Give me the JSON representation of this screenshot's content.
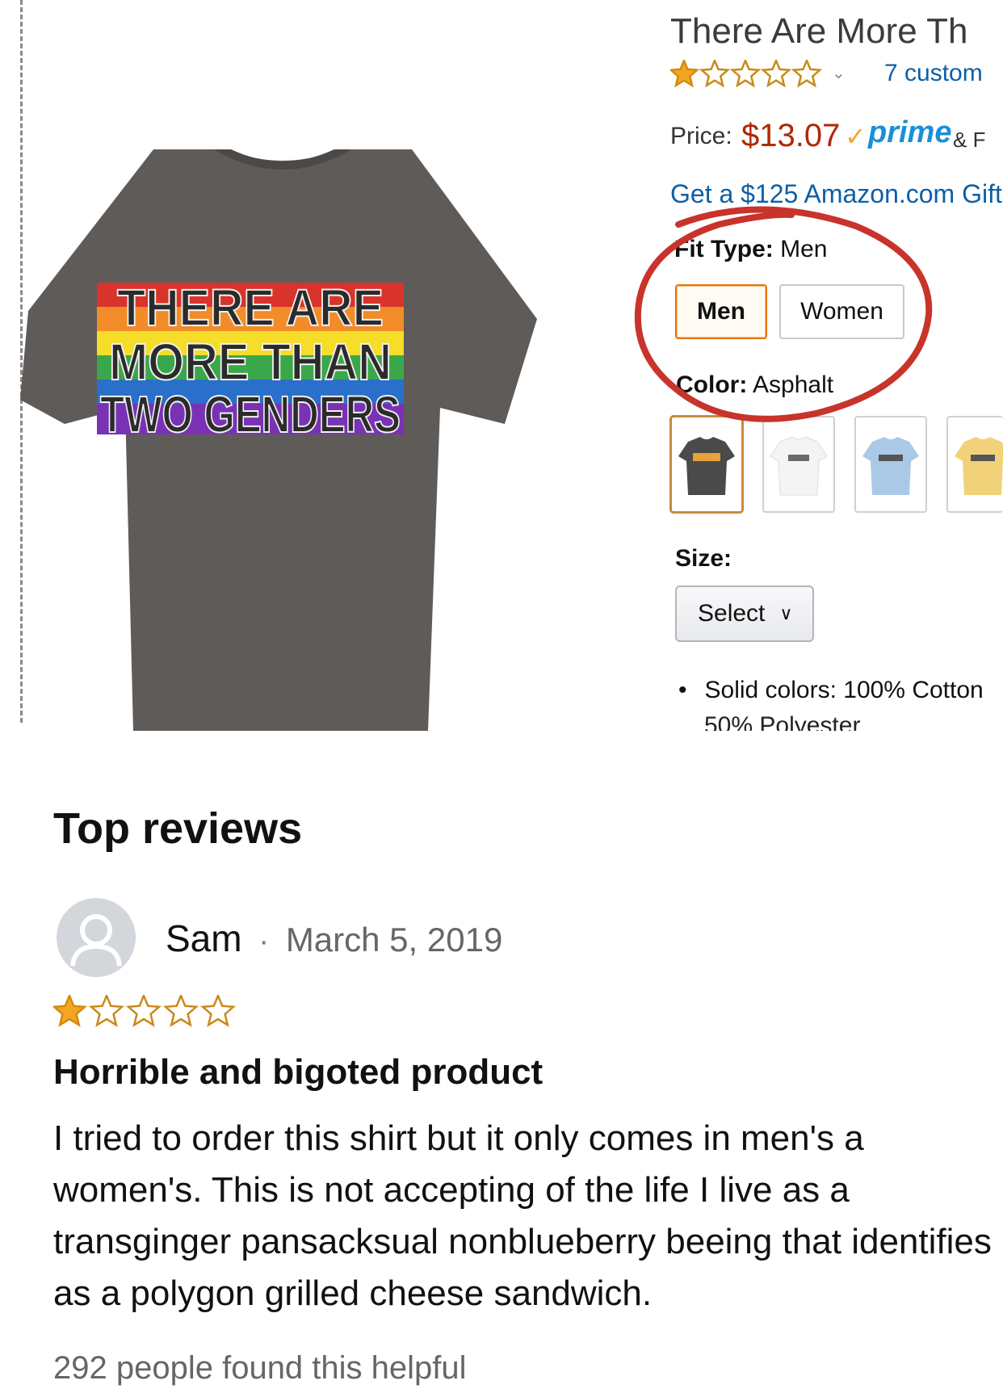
{
  "product": {
    "title": "There Are More Th",
    "rating_stars": 1,
    "customer_reviews": "7 custom",
    "price_label": "Price:",
    "price_value": "$13.07",
    "prime_check": "✓",
    "prime_label": "prime",
    "prime_suffix": "& F",
    "gift_link": "Get a $125 Amazon.com Gift",
    "fit_type_label": "Fit Type:",
    "fit_type_value": "Men",
    "fit_options": [
      "Men",
      "Women"
    ],
    "selected_fit": "Men",
    "color_label": "Color:",
    "color_value": "Asphalt",
    "swatch_colors": [
      "#4a4a4a",
      "#f4f4f4",
      "#a9c9e6",
      "#f1d27a"
    ],
    "size_label": "Size:",
    "size_select": "Select",
    "bullet_text": "Solid colors: 100% Cotton",
    "bullet_cut_text": "50% Polyester",
    "shirt_text": [
      "THERE ARE",
      "MORE THAN",
      "TWO GENDERS"
    ],
    "shirt_color": "#5f5b58",
    "annotation_color": "#c8332b"
  },
  "reviews": {
    "heading": "Top reviews",
    "items": [
      {
        "reviewer": "Sam",
        "separator": "·",
        "date": "March 5, 2019",
        "stars": 1,
        "title": "Horrible and bigoted product",
        "body": "I tried to order this shirt but it only comes in men's a women's. This is not accepting of the life I live as a transginger pansacksual nonblueberry beeing that identifies as a polygon grilled cheese sandwich.",
        "helpful": "292 people found this helpful"
      }
    ]
  }
}
